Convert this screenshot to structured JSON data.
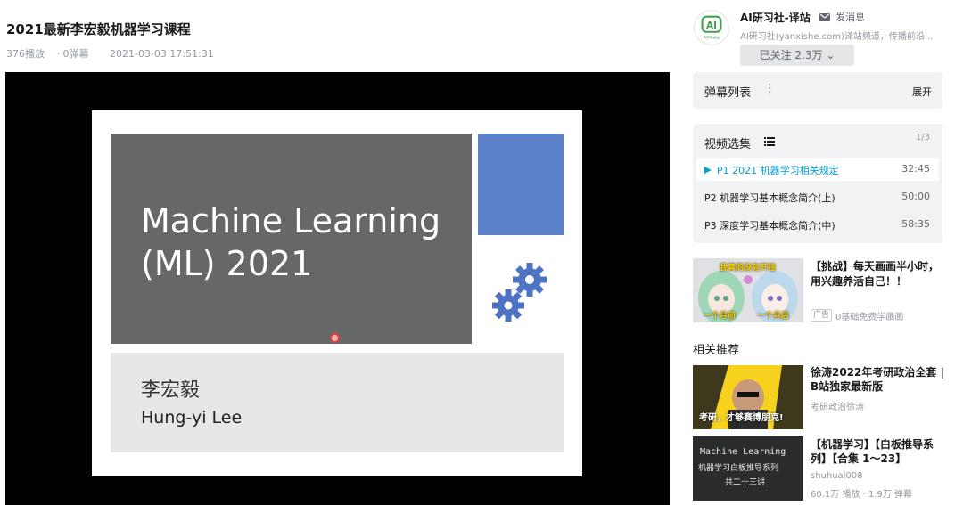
{
  "video": {
    "title": "2021最新李宏毅机器学习课程",
    "plays": "376播放",
    "danmaku_count": "0弹幕",
    "datetime": "2021-03-03 17:51:31"
  },
  "slide": {
    "title_line1": "Machine Learning",
    "title_line2": "(ML) 2021",
    "author_cn": "李宏毅",
    "author_en": "Hung-yi Lee"
  },
  "uploader": {
    "avatar_text": "AI",
    "avatar_sub": "Affiliate",
    "name": "AI研习社-译站",
    "message_label": "发消息",
    "description": "AI研习社(yanxishe.com)译站频道，传播前沿...",
    "follow_label": "已关注 2.3万"
  },
  "danmaku_panel": {
    "title": "弹幕列表",
    "expand_label": "展开"
  },
  "episodes": {
    "title": "视频选集",
    "count": "1/3",
    "items": [
      {
        "label": "P1  2021 机器学习相关规定",
        "duration": "32:45"
      },
      {
        "label": "P2  机器学习基本概念简介(上)",
        "duration": "50:00"
      },
      {
        "label": "P3  深度学习基本概念简介(中)",
        "duration": "58:35"
      }
    ]
  },
  "ad": {
    "thumb_caption_top": "我真的没有开挂",
    "thumb_caption_left": "一个月前",
    "thumb_caption_right": "一个月后",
    "title": "【挑战】每天画画半小时，用兴趣养活自己！！",
    "tag": "广告",
    "subtitle": "0基础免费学画画"
  },
  "related": {
    "heading": "相关推荐",
    "items": [
      {
        "thumb_caption": "考研，才够赛博朋克!",
        "title": "徐涛2022年考研政治全套 | B站独家最新版",
        "author": "考研政治徐涛"
      },
      {
        "thumb_line1": "Machine Learning",
        "thumb_line2": "机器学习白板推导系列",
        "thumb_line3": "共二十三讲",
        "title": "【机器学习】【白板推导系列】【合集 1～23】",
        "author": "shuhuai008",
        "stats": "60.1万 播放 · 1.9万 弹幕"
      }
    ]
  }
}
